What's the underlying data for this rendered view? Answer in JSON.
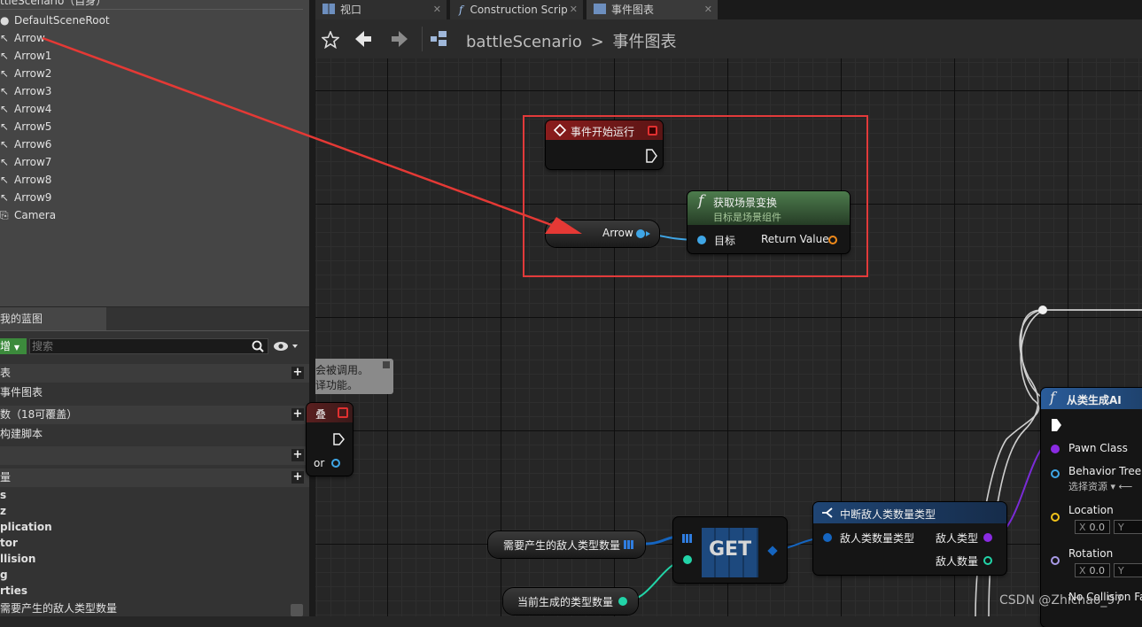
{
  "components": {
    "header": "ttleScenario（自身）",
    "root": "DefaultSceneRoot",
    "items": [
      "Arrow",
      "Arrow1",
      "Arrow2",
      "Arrow3",
      "Arrow4",
      "Arrow5",
      "Arrow6",
      "Arrow7",
      "Arrow8",
      "Arrow9"
    ],
    "camera": "Camera"
  },
  "my_blueprint": {
    "tab_label": "我的蓝图",
    "add_label": "增",
    "search_placeholder": "搜索",
    "rows": [
      {
        "text": "表",
        "category": true,
        "plus": true
      },
      {
        "text": "事件图表",
        "category": false,
        "plus": false
      },
      {
        "text": "数（18可覆盖）",
        "category": true,
        "plus": true
      },
      {
        "text": "构建脚本",
        "category": false,
        "plus": false
      },
      {
        "text": "",
        "category": true,
        "plus": true
      },
      {
        "text": "量",
        "category": true,
        "plus": true
      },
      {
        "text": "s",
        "category": false,
        "plus": false
      },
      {
        "text": "z",
        "category": false,
        "plus": false
      },
      {
        "text": "plication",
        "category": false,
        "plus": false
      },
      {
        "text": "tor",
        "category": false,
        "plus": false
      },
      {
        "text": "llision",
        "category": false,
        "plus": false
      },
      {
        "text": "g",
        "category": false,
        "plus": false
      },
      {
        "text": "rties",
        "category": false,
        "plus": false
      },
      {
        "text": "需要产生的敌人类型数量",
        "category": false,
        "plus": false
      }
    ]
  },
  "tabs": [
    {
      "label": "视口",
      "icon": "viewport-icon"
    },
    {
      "label": "Construction Scrip",
      "icon": "function-icon"
    },
    {
      "label": "事件图表",
      "icon": "graph-icon"
    }
  ],
  "breadcrumb": {
    "root": "battleScenario",
    "separator": ">",
    "current": "事件图表"
  },
  "nodes": {
    "begin_play": {
      "title": "事件开始运行"
    },
    "arrow_getter": {
      "label": "Arrow"
    },
    "get_transform": {
      "title": "获取场景变换",
      "subtitle": "目标是场景组件",
      "target_label": "目标",
      "return_label": "Return Value"
    },
    "comment_fragment": {
      "line1": "会被调用。",
      "line2": "译功能。"
    },
    "partial_event": {
      "title": "叠",
      "pin_label": "or"
    },
    "spawn_ai": {
      "title": "从类生成AI",
      "pawn_class": "Pawn Class",
      "behavior_tree": "Behavior Tree",
      "select_asset": "选择资源",
      "location": "Location",
      "rotation": "Rotation",
      "no_collision": "No Collision Fa",
      "x_label": "X",
      "y_label": "Y",
      "loc_x": "0.0",
      "rot_x": "0.0"
    },
    "break_struct": {
      "title": "中断敌人类数量类型",
      "input_label": "敌人类数量类型",
      "out_type": "敌人类型",
      "out_count": "敌人数量"
    },
    "get_node": {
      "label": "GET"
    },
    "var_enemy_types": {
      "label": "需要产生的敌人类型数量"
    },
    "var_current_count": {
      "label": "当前生成的类型数量"
    }
  },
  "watermark": "CSDN @Zhichao_97"
}
